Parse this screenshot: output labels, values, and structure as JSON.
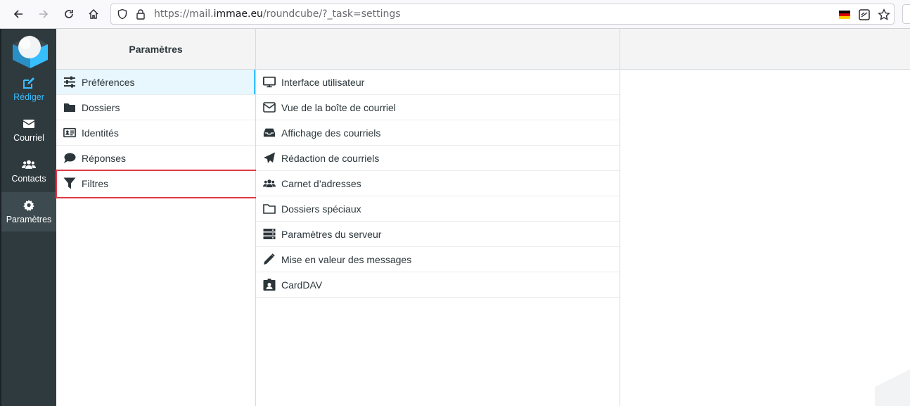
{
  "browser": {
    "url_prefix": "https://mail.",
    "url_domain": "immae.eu",
    "url_suffix": "/roundcube/?_task=settings"
  },
  "sidebar": {
    "items": [
      {
        "label": "Rédiger",
        "icon": "compose-icon"
      },
      {
        "label": "Courriel",
        "icon": "envelope-icon"
      },
      {
        "label": "Contacts",
        "icon": "users-icon"
      },
      {
        "label": "Paramètres",
        "icon": "gear-icon"
      }
    ]
  },
  "settings": {
    "title": "Paramètres",
    "sections": [
      {
        "label": "Préférences",
        "icon": "sliders-icon",
        "selected": true
      },
      {
        "label": "Dossiers",
        "icon": "folder-icon"
      },
      {
        "label": "Identités",
        "icon": "id-card-icon"
      },
      {
        "label": "Réponses",
        "icon": "comment-icon"
      },
      {
        "label": "Filtres",
        "icon": "filter-icon"
      }
    ]
  },
  "preferences": {
    "items": [
      {
        "label": "Interface utilisateur",
        "icon": "monitor-icon"
      },
      {
        "label": "Vue de la boîte de courriel",
        "icon": "envelope-outline-icon"
      },
      {
        "label": "Affichage des courriels",
        "icon": "inbox-icon"
      },
      {
        "label": "Rédaction de courriels",
        "icon": "paper-plane-icon"
      },
      {
        "label": "Carnet d’adresses",
        "icon": "users-icon"
      },
      {
        "label": "Dossiers spéciaux",
        "icon": "folder-outline-icon"
      },
      {
        "label": "Paramètres du serveur",
        "icon": "server-icon"
      },
      {
        "label": "Mise en valeur des messages",
        "icon": "pencil-icon"
      },
      {
        "label": "CardDAV",
        "icon": "id-badge-icon"
      }
    ]
  },
  "colors": {
    "accent": "#37beff",
    "sidebar": "#2f3a3f",
    "highlight": "#e03a46"
  }
}
